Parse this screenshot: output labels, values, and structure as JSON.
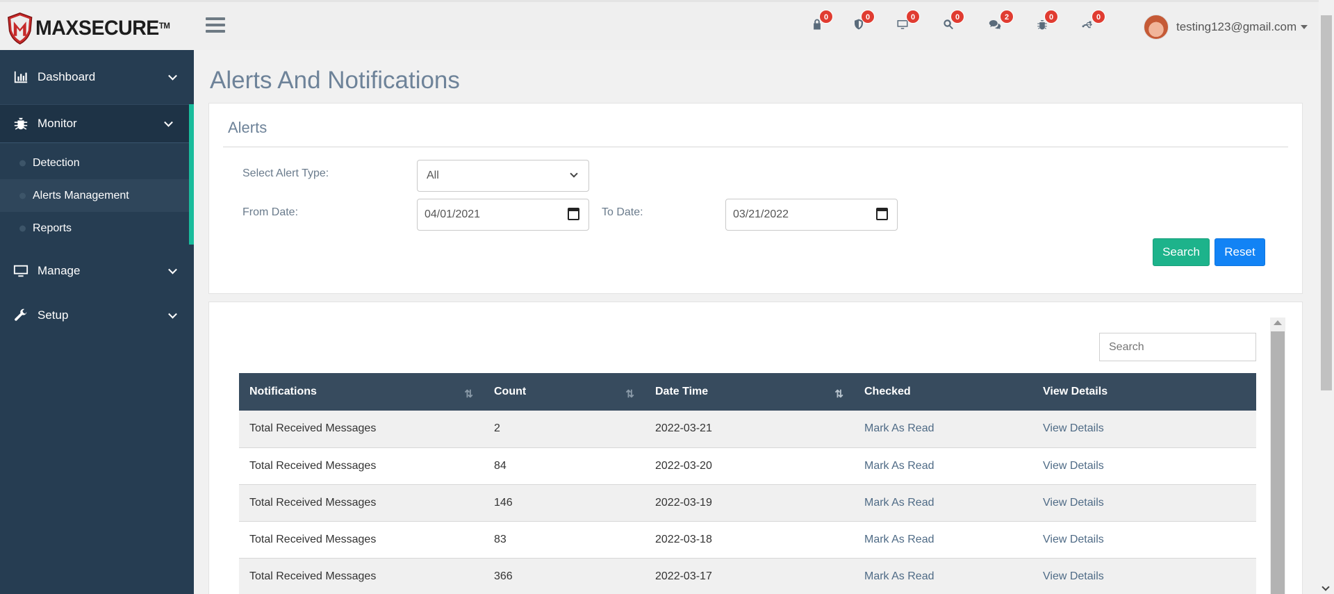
{
  "brand": {
    "name": "MAXSECURE",
    "tm": "TM"
  },
  "topbar": {
    "notifications": [
      {
        "icon": "lock-icon",
        "count": "0"
      },
      {
        "icon": "shield-icon",
        "count": "0"
      },
      {
        "icon": "monitor-icon",
        "count": "0"
      },
      {
        "icon": "search-icon",
        "count": "0"
      },
      {
        "icon": "chat-icon",
        "count": "2"
      },
      {
        "icon": "bug-icon",
        "count": "0"
      },
      {
        "icon": "usb-icon",
        "count": "0"
      }
    ],
    "user_email": "testing123@gmail.com"
  },
  "sidebar": {
    "items": [
      {
        "label": "Dashboard"
      },
      {
        "label": "Monitor"
      },
      {
        "label": "Manage"
      },
      {
        "label": "Setup"
      }
    ],
    "monitor_sub": [
      {
        "label": "Detection"
      },
      {
        "label": "Alerts Management"
      },
      {
        "label": "Reports"
      }
    ]
  },
  "page": {
    "title": "Alerts And Notifications"
  },
  "filter": {
    "title": "Alerts",
    "alert_type_label": "Select Alert Type:",
    "alert_type_value": "All",
    "from_label": "From Date:",
    "from_value": "04/01/2021",
    "to_label": "To Date:",
    "to_value": "03/21/2022",
    "search_button": "Search",
    "reset_button": "Reset"
  },
  "table": {
    "search_placeholder": "Search",
    "columns": [
      "Notifications",
      "Count",
      "Date Time",
      "Checked",
      "View Details"
    ],
    "rows": [
      {
        "notification": "Total Received Messages",
        "count": "2",
        "datetime": "2022-03-21",
        "checked": "Mark As Read",
        "details": "View Details"
      },
      {
        "notification": "Total Received Messages",
        "count": "84",
        "datetime": "2022-03-20",
        "checked": "Mark As Read",
        "details": "View Details"
      },
      {
        "notification": "Total Received Messages",
        "count": "146",
        "datetime": "2022-03-19",
        "checked": "Mark As Read",
        "details": "View Details"
      },
      {
        "notification": "Total Received Messages",
        "count": "83",
        "datetime": "2022-03-18",
        "checked": "Mark As Read",
        "details": "View Details"
      },
      {
        "notification": "Total Received Messages",
        "count": "366",
        "datetime": "2022-03-17",
        "checked": "Mark As Read",
        "details": "View Details"
      }
    ]
  },
  "colors": {
    "sidebar_bg": "#263d52",
    "accent": "#1abc9c",
    "table_header": "#374b5e",
    "search_btn": "#1db38b",
    "reset_btn": "#1283f5",
    "badge": "#e03c31",
    "title": "#6e8399"
  }
}
